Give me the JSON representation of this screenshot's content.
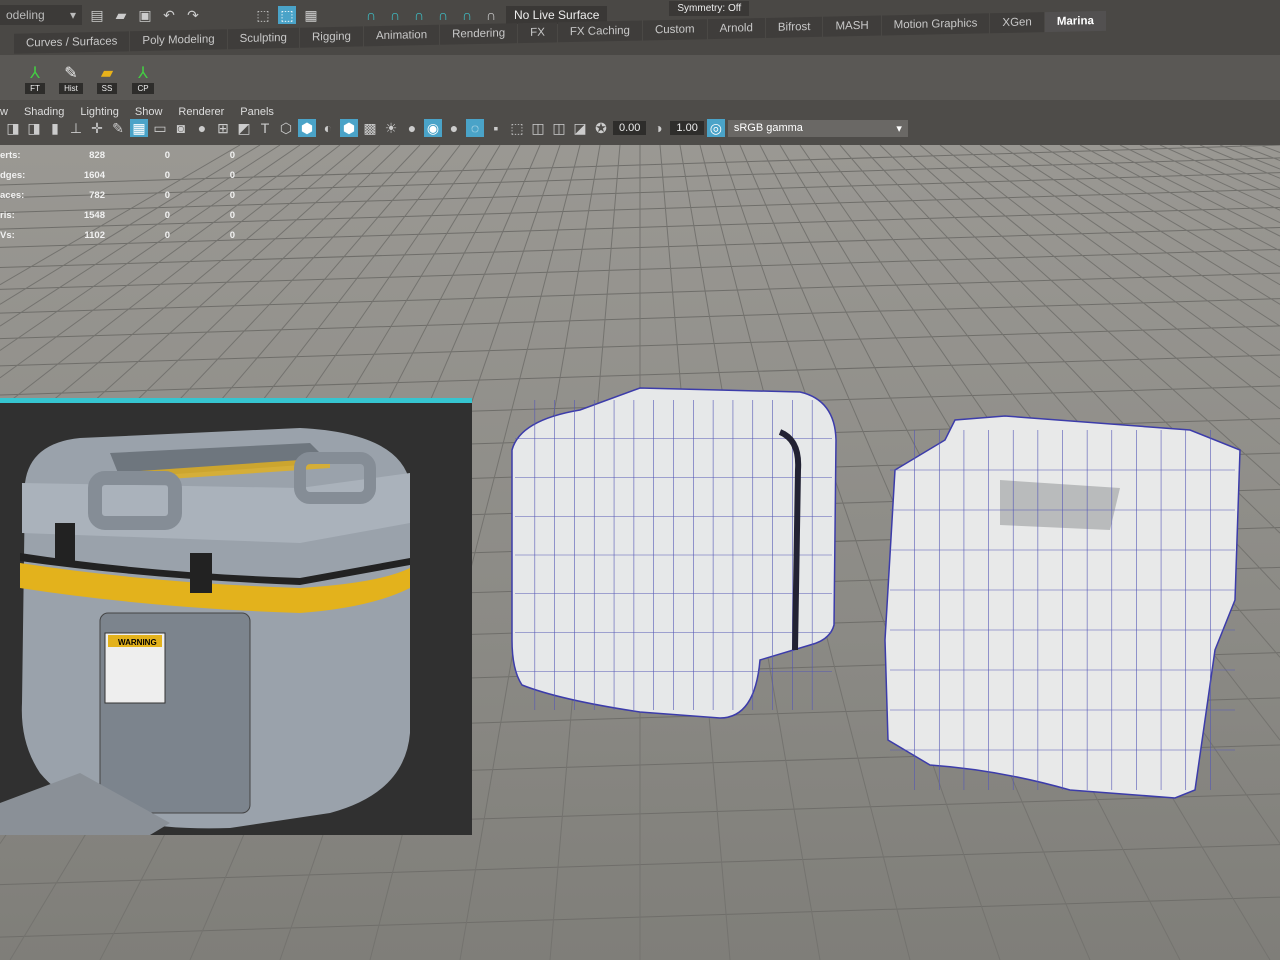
{
  "toolbar": {
    "mode": "odeling",
    "live_surface": "No Live Surface",
    "symmetry": "Symmetry: Off"
  },
  "shelf_tabs": [
    "Curves / Surfaces",
    "Poly Modeling",
    "Sculpting",
    "Rigging",
    "Animation",
    "Rendering",
    "FX",
    "FX Caching",
    "Custom",
    "Arnold",
    "Bifrost",
    "MASH",
    "Motion Graphics",
    "XGen",
    "Marina"
  ],
  "active_shelf": "Marina",
  "shelf_buttons": [
    {
      "label": "FT",
      "icon": "axis-icon"
    },
    {
      "label": "Hist",
      "icon": "edit-icon"
    },
    {
      "label": "SS",
      "icon": "folder-icon"
    },
    {
      "label": "CP",
      "icon": "axis-icon"
    }
  ],
  "panel_menu": [
    "w",
    "Shading",
    "Lighting",
    "Show",
    "Renderer",
    "Panels"
  ],
  "exposure": "0.00",
  "gamma": "1.00",
  "color_space": "sRGB gamma",
  "hud": [
    {
      "label": "erts:",
      "a": "828",
      "b": "0",
      "c": "0"
    },
    {
      "label": "dges:",
      "a": "1604",
      "b": "0",
      "c": "0"
    },
    {
      "label": "aces:",
      "a": "782",
      "b": "0",
      "c": "0"
    },
    {
      "label": "ris:",
      "a": "1548",
      "b": "0",
      "c": "0"
    },
    {
      "label": "Vs:",
      "a": "1102",
      "b": "0",
      "c": "0"
    }
  ],
  "reference": {
    "label_text": "WARNING",
    "accent": "#36c5d0",
    "stripe": "#e8b21a"
  }
}
